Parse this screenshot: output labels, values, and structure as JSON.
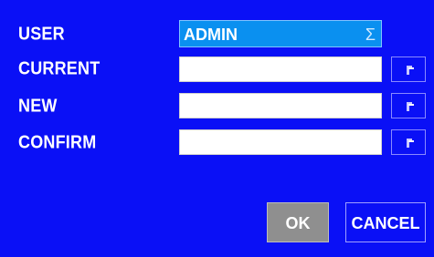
{
  "form": {
    "user_label": "USER",
    "current_label": "CURRENT",
    "new_label": "NEW",
    "confirm_label": "CONFIRM",
    "user_value": "ADMIN",
    "current_value": "",
    "new_value": "",
    "confirm_value": ""
  },
  "buttons": {
    "ok_label": "OK",
    "cancel_label": "CANCEL"
  },
  "icons": {
    "dropdown": "sigma-dropdown-icon",
    "keyboard": "virtual-keyboard-icon"
  },
  "colors": {
    "background": "#0a10f6",
    "selected": "#0a90f0",
    "disabled_button": "#8f8f8f"
  }
}
